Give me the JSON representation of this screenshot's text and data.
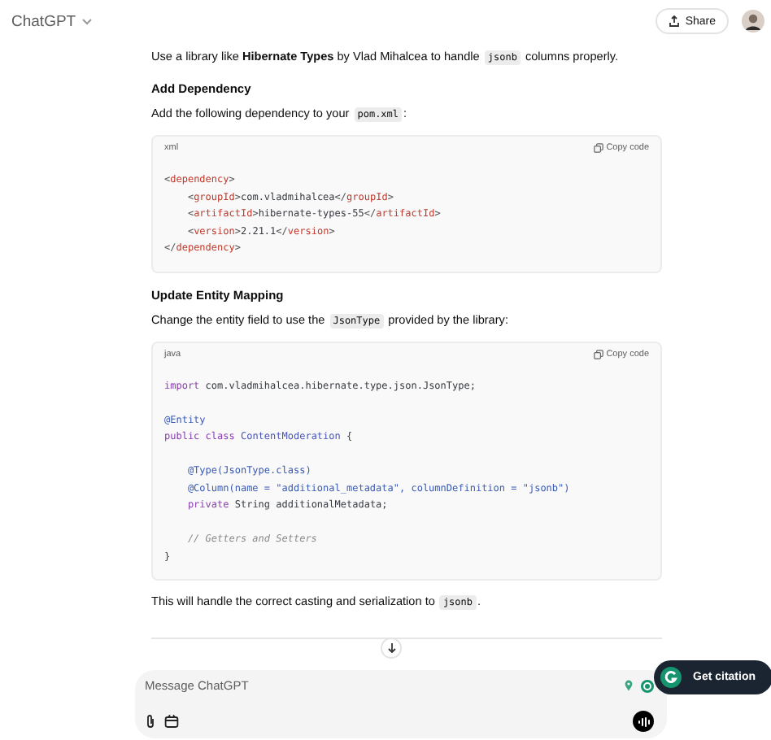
{
  "header": {
    "title": "ChatGPT",
    "share": "Share"
  },
  "blocks": [
    {
      "kind": "para",
      "parts": [
        {
          "kind": "text",
          "text": "Use a library like "
        },
        {
          "kind": "bold",
          "text": "Hibernate Types"
        },
        {
          "kind": "text",
          "text": " by Vlad Mihalcea to handle "
        },
        {
          "kind": "code",
          "text": "jsonb"
        },
        {
          "kind": "text",
          "text": " columns properly."
        }
      ]
    },
    {
      "kind": "heading",
      "text": "Add Dependency"
    },
    {
      "kind": "para",
      "parts": [
        {
          "kind": "text",
          "text": "Add the following dependency to your "
        },
        {
          "kind": "code",
          "text": "pom.xml"
        },
        {
          "kind": "text",
          "text": ":"
        }
      ]
    },
    {
      "kind": "codeblock",
      "language": "xml",
      "copy": "Copy code",
      "lines": [
        {
          "kind": "code",
          "tokens": [
            {
              "kind": "punct",
              "text": "<"
            },
            {
              "kind": "tag",
              "text": "dependency"
            },
            {
              "kind": "punct",
              "text": ">"
            }
          ]
        },
        {
          "kind": "code",
          "tokens": [
            {
              "kind": "punct",
              "text": "    <"
            },
            {
              "kind": "tag",
              "text": "groupId"
            },
            {
              "kind": "punct",
              "text": ">"
            },
            {
              "kind": "plain",
              "text": "com.vladmihalcea"
            },
            {
              "kind": "punct",
              "text": "</"
            },
            {
              "kind": "tag",
              "text": "groupId"
            },
            {
              "kind": "punct",
              "text": ">"
            }
          ]
        },
        {
          "kind": "code",
          "tokens": [
            {
              "kind": "punct",
              "text": "    <"
            },
            {
              "kind": "tag",
              "text": "artifactId"
            },
            {
              "kind": "punct",
              "text": ">"
            },
            {
              "kind": "plain",
              "text": "hibernate-types-55"
            },
            {
              "kind": "punct",
              "text": "</"
            },
            {
              "kind": "tag",
              "text": "artifactId"
            },
            {
              "kind": "punct",
              "text": ">"
            }
          ]
        },
        {
          "kind": "code",
          "tokens": [
            {
              "kind": "punct",
              "text": "    <"
            },
            {
              "kind": "tag",
              "text": "version"
            },
            {
              "kind": "punct",
              "text": ">"
            },
            {
              "kind": "plain",
              "text": "2.21.1"
            },
            {
              "kind": "punct",
              "text": "</"
            },
            {
              "kind": "tag",
              "text": "version"
            },
            {
              "kind": "punct",
              "text": ">"
            }
          ]
        },
        {
          "kind": "code",
          "tokens": [
            {
              "kind": "punct",
              "text": "</"
            },
            {
              "kind": "tag",
              "text": "dependency"
            },
            {
              "kind": "punct",
              "text": ">"
            }
          ]
        }
      ]
    },
    {
      "kind": "heading",
      "text": "Update Entity Mapping"
    },
    {
      "kind": "para",
      "parts": [
        {
          "kind": "text",
          "text": "Change the entity field to use the "
        },
        {
          "kind": "code",
          "text": "JsonType"
        },
        {
          "kind": "text",
          "text": " provided by the library:"
        }
      ]
    },
    {
      "kind": "codeblock",
      "language": "java",
      "copy": "Copy code",
      "lines": [
        {
          "kind": "code",
          "tokens": [
            {
              "kind": "keyword",
              "text": "import"
            },
            {
              "kind": "plain",
              "text": " com.vladmihalcea.hibernate.type.json.JsonType;"
            }
          ]
        },
        {
          "kind": "blank"
        },
        {
          "kind": "code",
          "tokens": [
            {
              "kind": "annotation",
              "text": "@Entity"
            }
          ]
        },
        {
          "kind": "code",
          "tokens": [
            {
              "kind": "keyword",
              "text": "public class "
            },
            {
              "kind": "type",
              "text": "ContentModeration"
            },
            {
              "kind": "plain",
              "text": " {"
            }
          ]
        },
        {
          "kind": "blank"
        },
        {
          "kind": "code",
          "tokens": [
            {
              "kind": "annotation",
              "text": "    @Type(JsonType.class)"
            }
          ]
        },
        {
          "kind": "code",
          "tokens": [
            {
              "kind": "annotation",
              "text": "    @Column(name = \"additional_metadata\", columnDefinition = \"jsonb\")"
            }
          ]
        },
        {
          "kind": "code",
          "tokens": [
            {
              "kind": "keyword",
              "text": "    private"
            },
            {
              "kind": "plain",
              "text": " String additionalMetadata;"
            }
          ]
        },
        {
          "kind": "blank"
        },
        {
          "kind": "code",
          "tokens": [
            {
              "kind": "comment",
              "text": "    // Getters and Setters"
            }
          ]
        },
        {
          "kind": "code",
          "tokens": [
            {
              "kind": "plain",
              "text": "}"
            }
          ]
        }
      ]
    },
    {
      "kind": "para",
      "parts": [
        {
          "kind": "text",
          "text": "This will handle the correct casting and serialization to "
        },
        {
          "kind": "code",
          "text": "jsonb"
        },
        {
          "kind": "text",
          "text": "."
        }
      ]
    }
  ],
  "composer": {
    "placeholder": "Message ChatGPT"
  },
  "citation": {
    "label": "Get citation"
  }
}
